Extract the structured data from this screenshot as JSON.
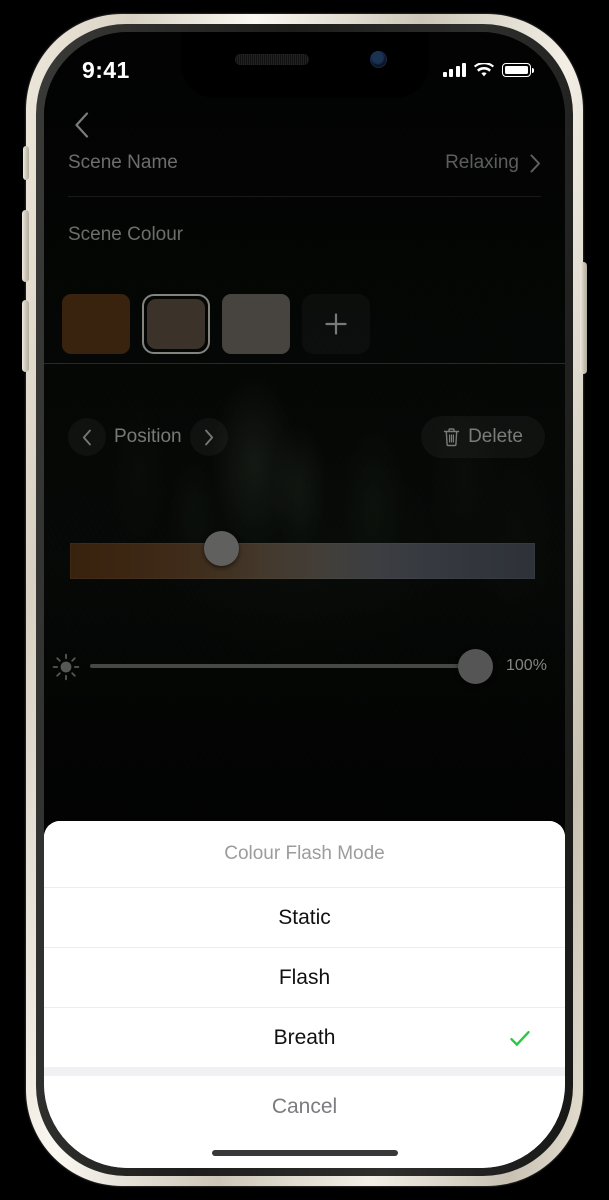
{
  "status_bar": {
    "time": "9:41",
    "cellular_icon": "cellular-signal-icon",
    "wifi_icon": "wifi-icon",
    "battery_icon": "battery-full-icon"
  },
  "nav": {
    "back_icon": "chevron-left-icon"
  },
  "scene": {
    "name_label": "Scene Name",
    "name_value": "Relaxing",
    "name_chevron_icon": "chevron-right-icon",
    "colour_label": "Scene Colour",
    "swatches": [
      {
        "name": "swatch-1",
        "color": "#4a2d12",
        "selected": false
      },
      {
        "name": "swatch-2",
        "color": "#4c4135",
        "selected": true
      },
      {
        "name": "swatch-3",
        "color": "#5b5650",
        "selected": false
      }
    ],
    "add_swatch_icon": "plus-icon",
    "add_swatch_label": "+"
  },
  "position": {
    "label": "Position",
    "prev_icon": "chevron-left-icon",
    "next_icon": "chevron-right-icon"
  },
  "delete": {
    "label": "Delete",
    "icon": "trash-icon"
  },
  "gradient": {
    "name": "colour-gradient-slider",
    "stops": [
      "#4a2c11",
      "#53412c",
      "#55514a",
      "#454a52",
      "#3c4049"
    ],
    "handle_position_percent": 33
  },
  "brightness": {
    "icon": "sun-icon",
    "value_label": "100%",
    "value_percent": 100
  },
  "action_sheet": {
    "title": "Colour Flash Mode",
    "options": [
      {
        "label": "Static",
        "selected": false
      },
      {
        "label": "Flash",
        "selected": false
      },
      {
        "label": "Breath",
        "selected": true
      }
    ],
    "selected_icon": "check-icon",
    "selected_color": "#28c940",
    "cancel_label": "Cancel"
  },
  "home_indicator": "home-indicator"
}
